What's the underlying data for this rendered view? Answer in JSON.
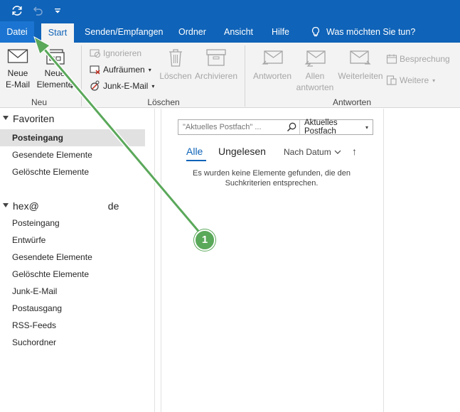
{
  "colors": {
    "brand": "#0f63b8",
    "ribbon_bg": "#f3f3f3",
    "annotation": "#5aa85a"
  },
  "quick_access": {
    "sync_icon": "sync-icon",
    "undo_icon": "undo-icon",
    "customize_icon": "customize-quick-access-icon"
  },
  "tabs": {
    "datei": "Datei",
    "start": "Start",
    "senden": "Senden/Empfangen",
    "ordner": "Ordner",
    "ansicht": "Ansicht",
    "hilfe": "Hilfe",
    "tell_me": "Was möchten Sie tun?"
  },
  "ribbon": {
    "neu": {
      "new_email": "Neue\nE-Mail",
      "new_items": "Neue\nElemente",
      "group": "Neu"
    },
    "loeschen": {
      "ignore": "Ignorieren",
      "cleanup": "Aufräumen",
      "junk": "Junk-E-Mail",
      "delete": "Löschen",
      "archive": "Archivieren",
      "group": "Löschen"
    },
    "antworten": {
      "reply": "Antworten",
      "reply_all": "Allen\nantworten",
      "forward": "Weiterleiten",
      "meeting": "Besprechung",
      "more": "Weitere",
      "group": "Antworten"
    }
  },
  "folders": {
    "favorites_label": "Favoriten",
    "favorites": [
      "Posteingang",
      "Gesendete Elemente",
      "Gelöschte Elemente"
    ],
    "account_prefix": "hex@",
    "account_suffix": "de",
    "account_folders": [
      "Posteingang",
      "Entwürfe",
      "Gesendete Elemente",
      "Gelöschte Elemente",
      "Junk-E-Mail",
      "Postausgang",
      "RSS-Feeds",
      "Suchordner"
    ]
  },
  "message_list": {
    "search_placeholder": "\"Aktuelles Postfach\" ...",
    "scope": "Aktuelles Postfach",
    "filter_all": "Alle",
    "filter_unread": "Ungelesen",
    "sort": "Nach Datum",
    "sort_direction": "↑",
    "empty_line1": "Es wurden keine Elemente gefunden, die den",
    "empty_line2": "Suchkriterien entsprechen."
  },
  "annotation": {
    "step": "1"
  }
}
